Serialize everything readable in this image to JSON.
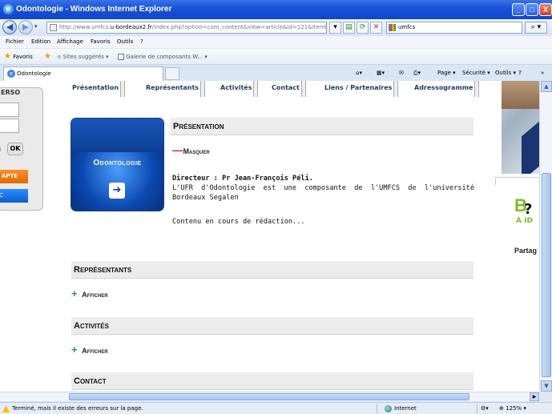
{
  "window": {
    "title": "Odontologie - Windows Internet Explorer",
    "controls": {
      "minimize": "_",
      "maximize": "□",
      "close": "X"
    }
  },
  "addressbar": {
    "url_prefix": "http://www.umfcs.",
    "url_domain": "u-bordeaux2.fr",
    "url_rest": "/index.php?option=com_content&view=article&id=121&Itemid=122",
    "search_value": "umfcs"
  },
  "menu": {
    "items": [
      "Fichier",
      "Edition",
      "Affichage",
      "Favoris",
      "Outils",
      "?"
    ]
  },
  "favorites": {
    "label": "Favoris",
    "suggested": "Sites suggérés ▾",
    "gallery": "Galerie de composants W... ▾"
  },
  "tab": {
    "label": "Odontologie"
  },
  "commandbar": {
    "page": "Page ▾",
    "security": "Sécurité ▾",
    "tools": "Outils ▾",
    "help": "?",
    "more": "»"
  },
  "leftpanel": {
    "label": "ERSO",
    "ok": "OK",
    "small": "i",
    "orange": "APTE",
    "blue": "C"
  },
  "nav": {
    "tabs": [
      "Présentation",
      "Représentants",
      "Activités",
      "Contact",
      "Liens / Partenaires",
      "Adressogramme"
    ]
  },
  "article": {
    "thumb_title": "Odontologie",
    "presentation_title": "Présentation",
    "hide_label": "Masquer",
    "director": "Directeur : Pr Jean-François Péli.",
    "description": "L'UFR d'Odontologie est une composante de l'UMFCS de l'université Bordeaux Segalen",
    "wip": "Contenu en cours de rédaction..."
  },
  "sections": [
    {
      "title": "Représentants",
      "toggle": "Afficher"
    },
    {
      "title": "Activités",
      "toggle": "Afficher"
    },
    {
      "title": "Contact"
    }
  ],
  "rightpanel": {
    "letter": "B",
    "q": "?",
    "tag": "À ID",
    "share": "Partag"
  },
  "status": {
    "message": "Terminé, mais il existe des erreurs sur la page.",
    "zone": "Internet",
    "zoom": "125%"
  },
  "colors": {
    "accent_blue": "#0b48b0",
    "hide_red": "#c21b1b",
    "show_teal": "#1f8fa0",
    "green": "#7dbb29"
  }
}
